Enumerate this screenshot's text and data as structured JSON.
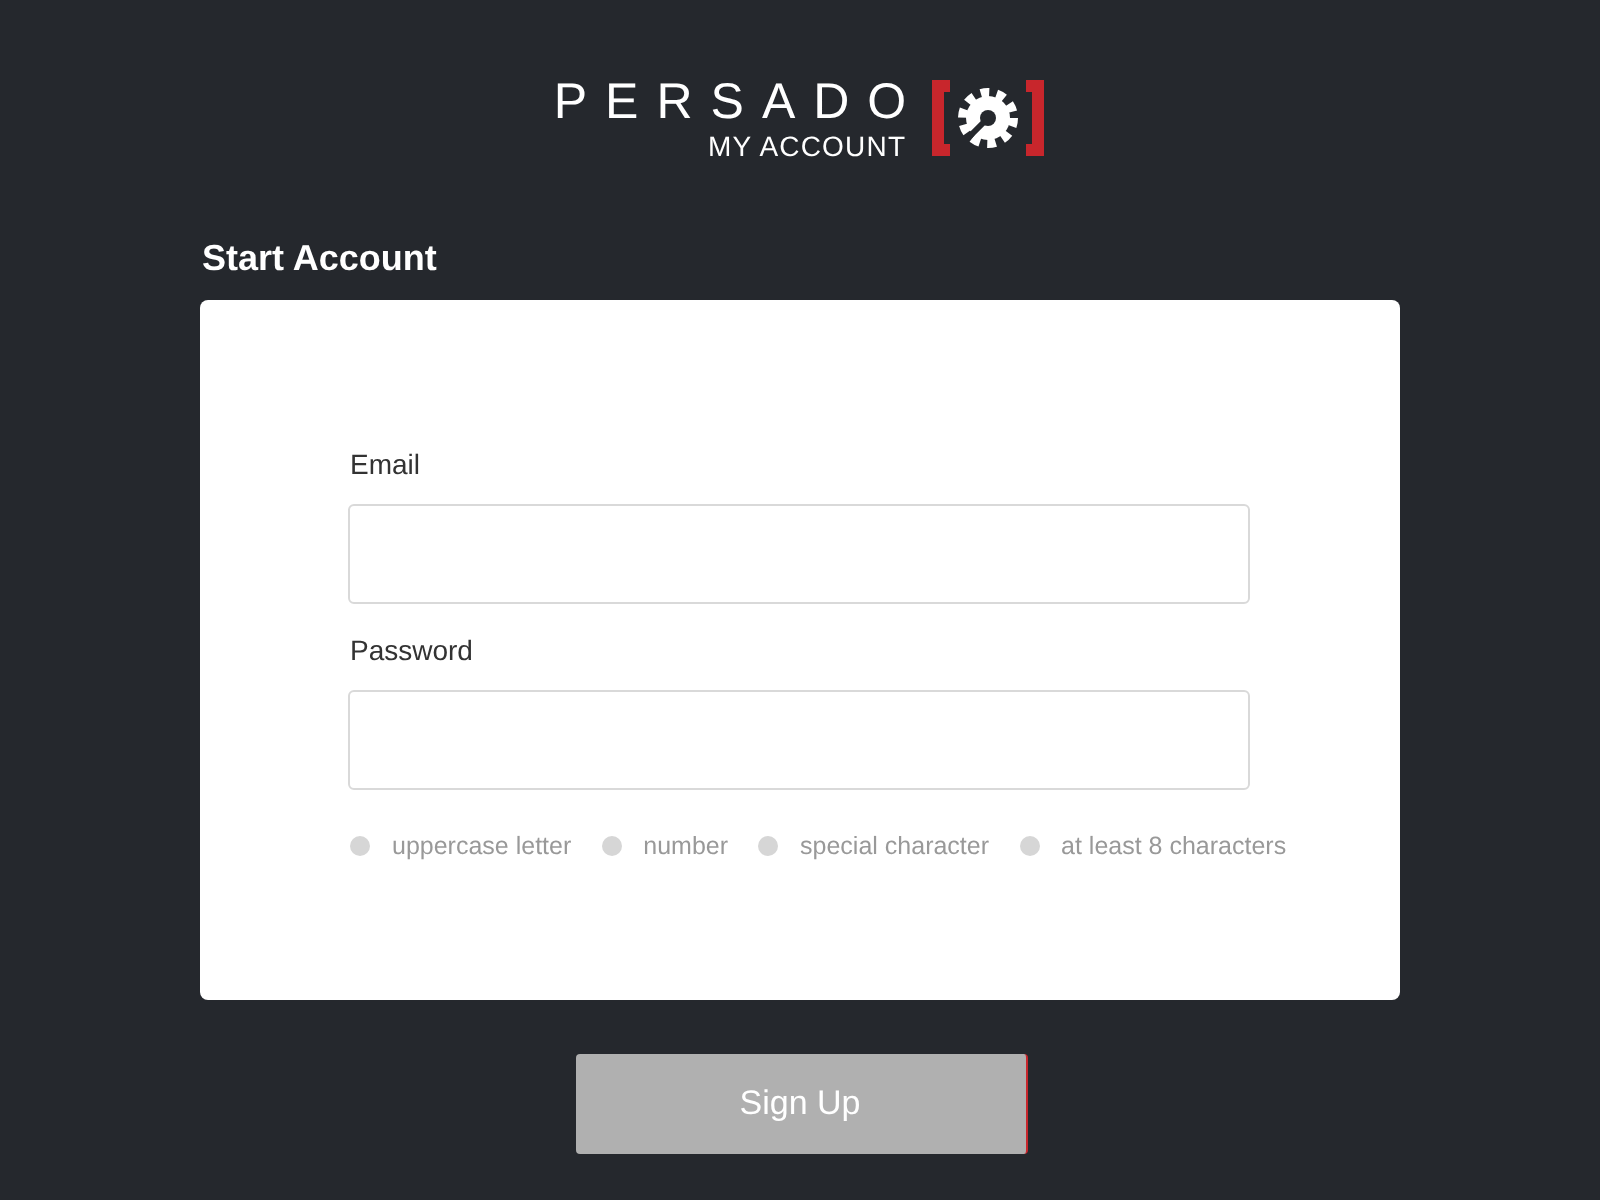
{
  "header": {
    "logo": {
      "wordmark": "PERSADO",
      "subtitle": "MY ACCOUNT"
    }
  },
  "form": {
    "title": "Start Account",
    "fields": [
      {
        "label": "Email"
      },
      {
        "label": "Password"
      }
    ],
    "password_requirements": [
      {
        "label": "uppercase letter",
        "met": false
      },
      {
        "label": "number",
        "met": false
      },
      {
        "label": "special character",
        "met": false
      },
      {
        "label": "at least 8 characters",
        "met": false
      }
    ]
  },
  "submit_button": {
    "label": "Sign Up",
    "disabled": true
  }
}
